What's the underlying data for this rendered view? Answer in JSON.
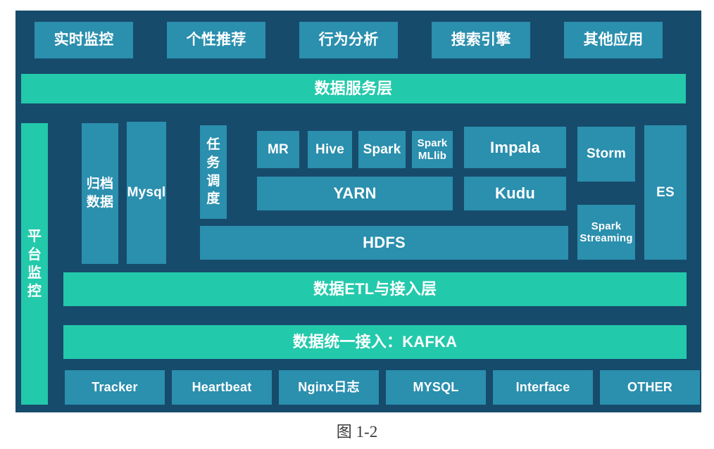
{
  "figure": {
    "caption_cn": "图",
    "caption_num": " 1-2"
  },
  "colors": {
    "panel_background": "#174b6b",
    "box_teal": "#2b8fae",
    "layer_green": "#23c9ab",
    "text": "#ffffff",
    "caption_text": "#3a3a3a"
  },
  "applications": {
    "items": [
      {
        "label": "实时监控"
      },
      {
        "label": "个性推荐"
      },
      {
        "label": "行为分析"
      },
      {
        "label": "搜索引擎"
      },
      {
        "label": "其他应用"
      }
    ]
  },
  "service_layer": {
    "label": "数据服务层"
  },
  "monitoring": {
    "label": "平台监控",
    "chars": [
      "平",
      "台",
      "监",
      "控"
    ]
  },
  "storage": {
    "archive": {
      "line1": "归档",
      "line2": "数据"
    },
    "mysql": {
      "label": "Mysql"
    }
  },
  "scheduler": {
    "label": "任务调度",
    "chars": [
      "任",
      "务",
      "调",
      "度"
    ]
  },
  "compute": {
    "engines": [
      {
        "label": "MR"
      },
      {
        "label": "Hive"
      },
      {
        "label": "Spark"
      },
      {
        "label": "Spark",
        "label2": "MLlib"
      }
    ],
    "resource_manager": {
      "label": "YARN"
    },
    "filesystem": {
      "label": "HDFS"
    }
  },
  "query": {
    "impala": {
      "label": "Impala"
    },
    "kudu": {
      "label": "Kudu"
    }
  },
  "streaming": {
    "storm": {
      "label": "Storm"
    },
    "spark_streaming": {
      "label": "Spark",
      "label2": "Streaming"
    }
  },
  "search": {
    "es": {
      "label": "ES"
    }
  },
  "etl_layer": {
    "label": "数据ETL与接入层"
  },
  "ingest_layer": {
    "label": "数据统一接入：KAFKA"
  },
  "sources": {
    "items": [
      {
        "label": "Tracker"
      },
      {
        "label": "Heartbeat"
      },
      {
        "label": "Nginx日志"
      },
      {
        "label": "MYSQL"
      },
      {
        "label": "Interface"
      },
      {
        "label": "OTHER"
      }
    ]
  }
}
